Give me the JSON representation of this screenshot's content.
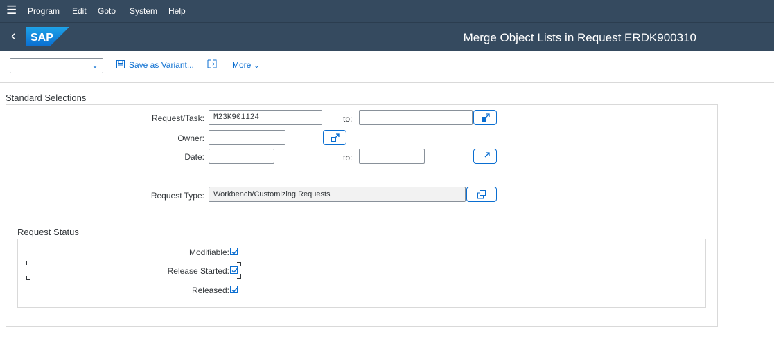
{
  "menu": {
    "items": [
      "Program",
      "Edit",
      "Goto",
      "System",
      "Help"
    ]
  },
  "header": {
    "logo_text": "SAP",
    "title": "Merge Object Lists in Request ERDK900310"
  },
  "toolbar": {
    "variant_value": "",
    "save_variant_label": "Save as Variant...",
    "more_label": "More"
  },
  "standard_selections": {
    "title": "Standard Selections",
    "to_label": "to:",
    "request_task_label": "Request/Task:",
    "request_task_value": "M23K901124",
    "request_task_to_value": "",
    "owner_label": "Owner:",
    "owner_value": "",
    "date_label": "Date:",
    "date_value": "",
    "date_to_value": "",
    "request_type_label": "Request Type:",
    "request_type_value": "Workbench/Customizing Requests"
  },
  "request_status": {
    "title": "Request Status",
    "items": [
      {
        "label": "Modifiable:",
        "checked": true
      },
      {
        "label": "Release Started:",
        "checked": true
      },
      {
        "label": "Released:",
        "checked": true
      }
    ]
  },
  "colors": {
    "shell": "#354a5f",
    "accent": "#0a6ed1",
    "border": "#d9d9d9"
  }
}
